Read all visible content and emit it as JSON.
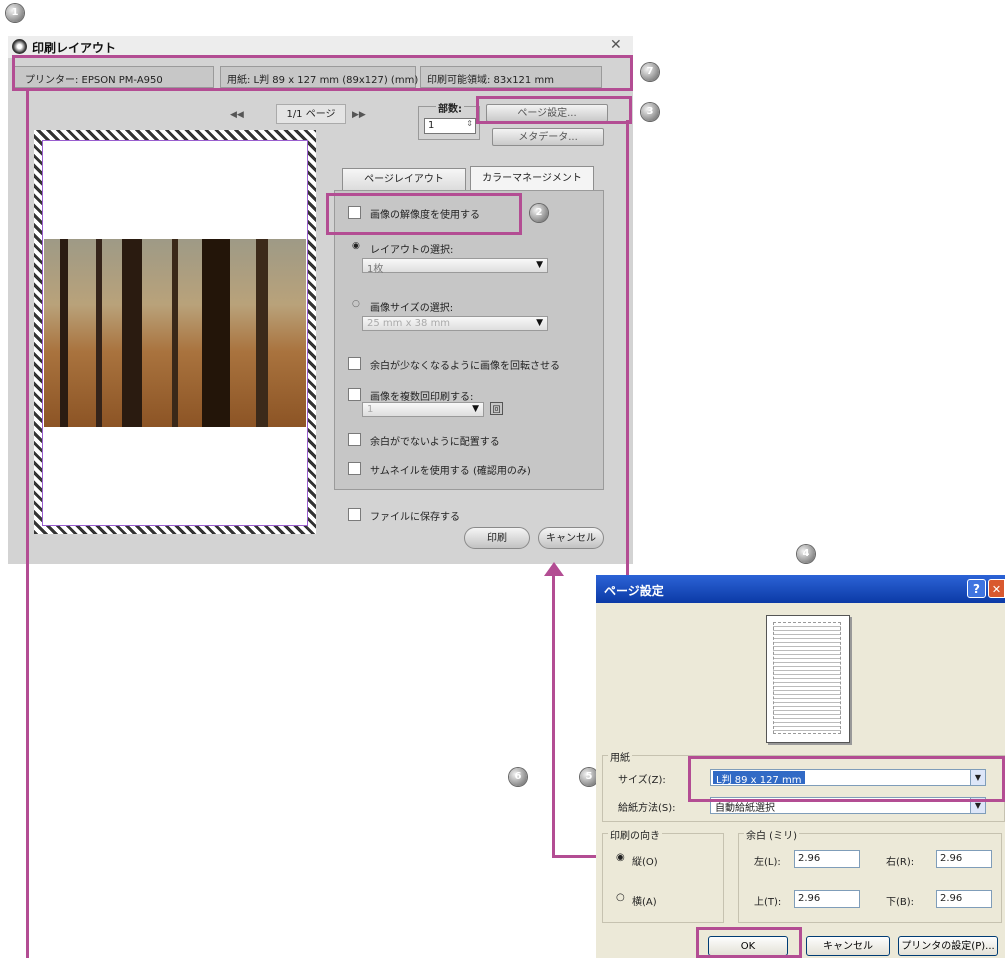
{
  "main_dialog": {
    "title": "印刷レイアウト",
    "close": "✕",
    "info": {
      "printer": "プリンター: EPSON PM-A950",
      "paper": "用紙: L判 89 x 127 mm (89x127) (mm)",
      "printable": "印刷可能領域: 83x121 mm"
    },
    "pager": {
      "prev": "◀◀",
      "page": "1/1 ページ",
      "next": "▶▶"
    },
    "copies": {
      "label": "部数:",
      "value": "1"
    },
    "page_setup_button": "ページ設定...",
    "metadata_button": "メタデータ...",
    "tabs": [
      "ページレイアウト",
      "カラーマネージメント"
    ],
    "options": {
      "use_resolution": "画像の解像度を使用する",
      "layout_select": "レイアウトの選択:",
      "layout_value": "1枚",
      "size_select": "画像サイズの選択:",
      "size_value": "25 mm x 38 mm",
      "rotate": "余白が少なくなるように画像を回転させる",
      "repeat": "画像を複数回印刷する:",
      "repeat_value": "1",
      "repeat_suffix": "回",
      "no_margin": "余白がでないように配置する",
      "thumbnail": "サムネイルを使用する (確認用のみ)"
    },
    "save_to_file": "ファイルに保存する",
    "print_button": "印刷",
    "cancel_button": "キャンセル"
  },
  "page_setup_dialog": {
    "title": "ページ設定",
    "help": "?",
    "close": "✕",
    "paper_group": "用紙",
    "size_label": "サイズ(Z):",
    "size_value": "L判 89 x 127 mm",
    "source_label": "給紙方法(S):",
    "source_value": "自動給紙選択",
    "orientation_group": "印刷の向き",
    "portrait": "縦(O)",
    "landscape": "横(A)",
    "margins_group": "余白 (ミリ)",
    "left_label": "左(L):",
    "left_value": "2.96",
    "right_label": "右(R):",
    "right_value": "2.96",
    "top_label": "上(T):",
    "top_value": "2.96",
    "bottom_label": "下(B):",
    "bottom_value": "2.96",
    "ok_button": "OK",
    "cancel_button": "キャンセル",
    "printer_button": "プリンタの設定(P)..."
  },
  "callouts": [
    "1",
    "2",
    "3",
    "4",
    "5",
    "6",
    "7"
  ],
  "colors": {
    "highlight": "#b34d93",
    "xp_title": "#0b3aa6"
  }
}
